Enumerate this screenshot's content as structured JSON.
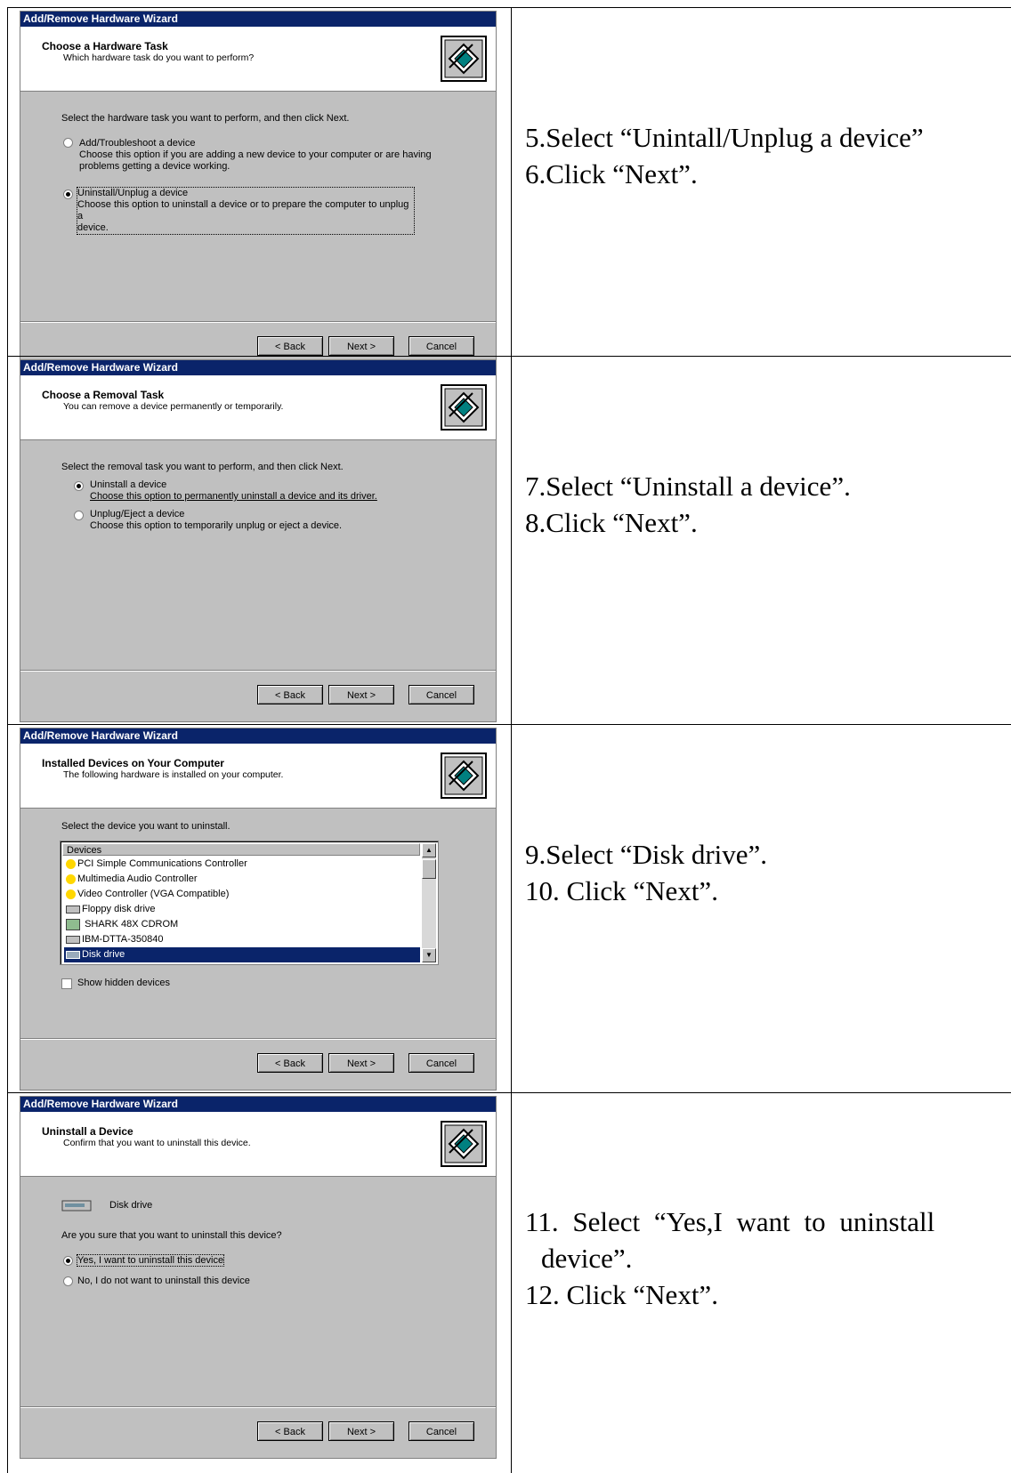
{
  "steps": [
    {
      "wizard": {
        "title": "Add/Remove Hardware Wizard",
        "heading": "Choose a Hardware Task",
        "subheading": "Which hardware task do you want to perform?",
        "prompt": "Select the hardware task you want to perform, and then click Next.",
        "options": [
          {
            "label": "Add/Troubleshoot a device",
            "desc1": "Choose this option if you are adding a new device to your computer or are having",
            "desc2": "problems getting a device working.",
            "selected": false
          },
          {
            "label": "Uninstall/Unplug a device",
            "desc1": "Choose this option to uninstall a device or to prepare the computer to unplug a",
            "desc2": "device.",
            "selected": true
          }
        ],
        "back": "< Back",
        "next": "Next >",
        "cancel": "Cancel"
      },
      "instructions": [
        "5.Select “Unintall/Unplug a device”",
        "6.Click “Next”."
      ]
    },
    {
      "wizard": {
        "title": "Add/Remove Hardware Wizard",
        "heading": "Choose a Removal Task",
        "subheading": "You can remove a device permanently or temporarily.",
        "prompt": "Select the removal task you want to perform, and then click Next.",
        "options": [
          {
            "label": "Uninstall a device",
            "desc1": "Choose this option to permanently uninstall a device and its driver.",
            "selected": true
          },
          {
            "label": "Unplug/Eject a device",
            "desc1": "Choose this option to temporarily unplug or eject a device.",
            "selected": false
          }
        ],
        "back": "< Back",
        "next": "Next >",
        "cancel": "Cancel"
      },
      "instructions": [
        "7.Select “Uninstall a device”.",
        "8.Click “Next”."
      ]
    },
    {
      "wizard": {
        "title": "Add/Remove Hardware Wizard",
        "heading": "Installed Devices on Your Computer",
        "subheading": "The following hardware is installed on your computer.",
        "prompt": "Select the device you want to uninstall.",
        "list_header": "Devices",
        "devices": [
          "PCI Simple Communications Controller",
          "Multimedia Audio Controller",
          "Video Controller (VGA Compatible)",
          "Floppy disk drive",
          "SHARK 48X CDROM",
          "IBM-DTTA-350840",
          "Disk drive"
        ],
        "selected_device": "Disk drive",
        "show_hidden": "Show hidden devices",
        "back": "< Back",
        "next": "Next >",
        "cancel": "Cancel"
      },
      "instructions": [
        "9.Select “Disk drive”.",
        "10. Click “Next”."
      ]
    },
    {
      "wizard": {
        "title": "Add/Remove Hardware Wizard",
        "heading": "Uninstall a Device",
        "subheading": "Confirm that you want to uninstall this device.",
        "device_name": "Disk drive",
        "question": "Are you sure that you want to uninstall this device?",
        "options": [
          {
            "label": "Yes, I want to uninstall this device",
            "selected": true
          },
          {
            "label": "No, I do not want to uninstall this device",
            "selected": false
          }
        ],
        "back": "< Back",
        "next": "Next >",
        "cancel": "Cancel"
      },
      "instructions": [
        "11. Select “Yes,I want to uninstall",
        "device”.",
        "12. Click “Next”."
      ]
    }
  ]
}
